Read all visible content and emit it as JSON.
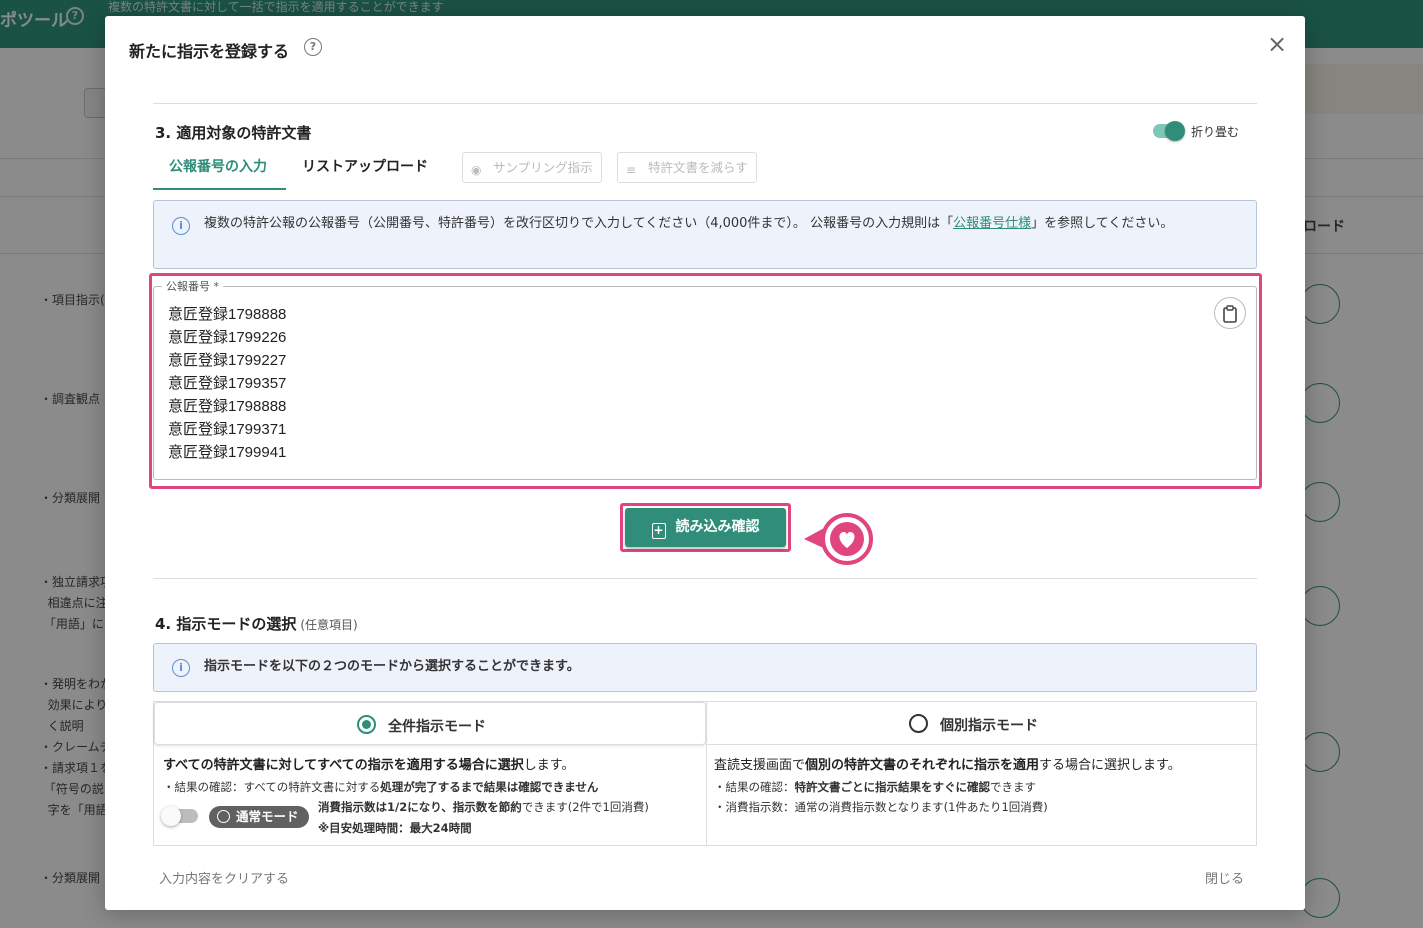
{
  "background": {
    "title": "ポツール",
    "help_icon": "question-circle-icon",
    "subtitle": "複数の特許文書に対して一括で指示を適用することができます",
    "column_header": "ロード",
    "items": [
      "・項目指示(v",
      "・調査観点【",
      "・分類展開【",
      "・独立請求項\n  相違点に注\n 「用語」に",
      "・発明をわか\n  効果により\n  く説明\n・クレームチ\n・請求項１を\n 「符号の説\n  字を「用語",
      "・分類展開【"
    ]
  },
  "modal": {
    "title": "新たに指示を登録する",
    "help_icon_glyph": "?",
    "close_glyph": "×",
    "section3": {
      "title": "3.  適用対象の特許文書",
      "collapse_label": "折り畳む",
      "collapse_on": true,
      "tabs": [
        {
          "label": "公報番号の入力",
          "active": true
        },
        {
          "label": "リストアップロード",
          "active": false
        }
      ],
      "sampling_button": "サンプリング指示",
      "reduce_button": "特許文書を減らす",
      "info_text_before": "複数の特許公報の公報番号（公開番号、特許番号）を改行区切りで入力してください（4,000件まで）。 公報番号の入力規則は「",
      "info_link": "公報番号仕様",
      "info_text_after": "」を参照してください。",
      "field_label": "公報番号 *",
      "field_lines": [
        "意匠登録1798888",
        "意匠登録1799226",
        "意匠登録1799227",
        "意匠登録1799357",
        "意匠登録1798888",
        "意匠登録1799371",
        "意匠登録1799941"
      ],
      "load_button": "読み込み確認"
    },
    "section4": {
      "title": "4.  指示モードの選択",
      "optional": "(任意項目)",
      "info_text": "指示モードを以下の２つのモードから選択することができます。",
      "modes": [
        {
          "label": "全件指示モード",
          "selected": true,
          "desc_strong": "すべての特許文書に対してすべての指示を適用する場合に選択",
          "desc_rest": "します。",
          "sub1_prefix": "・結果の確認：すべての特許文書に対する",
          "sub1_strong": "処理が完了するまで結果は確認できません",
          "chip_label": "通常モード",
          "chip_on": false,
          "sub2_strong": "消費指示数は1/2になり、指示数を節約",
          "sub2_rest": "できます(2件で1回消費)",
          "sub3": "※目安処理時間：最大24時間"
        },
        {
          "label": "個別指示モード",
          "selected": false,
          "desc_prefix": "査読支援画面で",
          "desc_strong": "個別の特許文書のそれぞれに指示を適用",
          "desc_rest": "する場合に選択します。",
          "sub1_prefix": "・結果の確認：",
          "sub1_strong": "特許文書ごとに指示結果をすぐに確認",
          "sub1_rest": "できます",
          "sub2": "・消費指示数：通常の消費指示数となります(1件あたり1回消費)"
        }
      ]
    },
    "footer": {
      "clear": "入力内容をクリアする",
      "close": "閉じる"
    }
  },
  "colors": {
    "accent": "#2f8d79",
    "highlight": "#e0457f",
    "info_bg": "#eef3fb"
  }
}
